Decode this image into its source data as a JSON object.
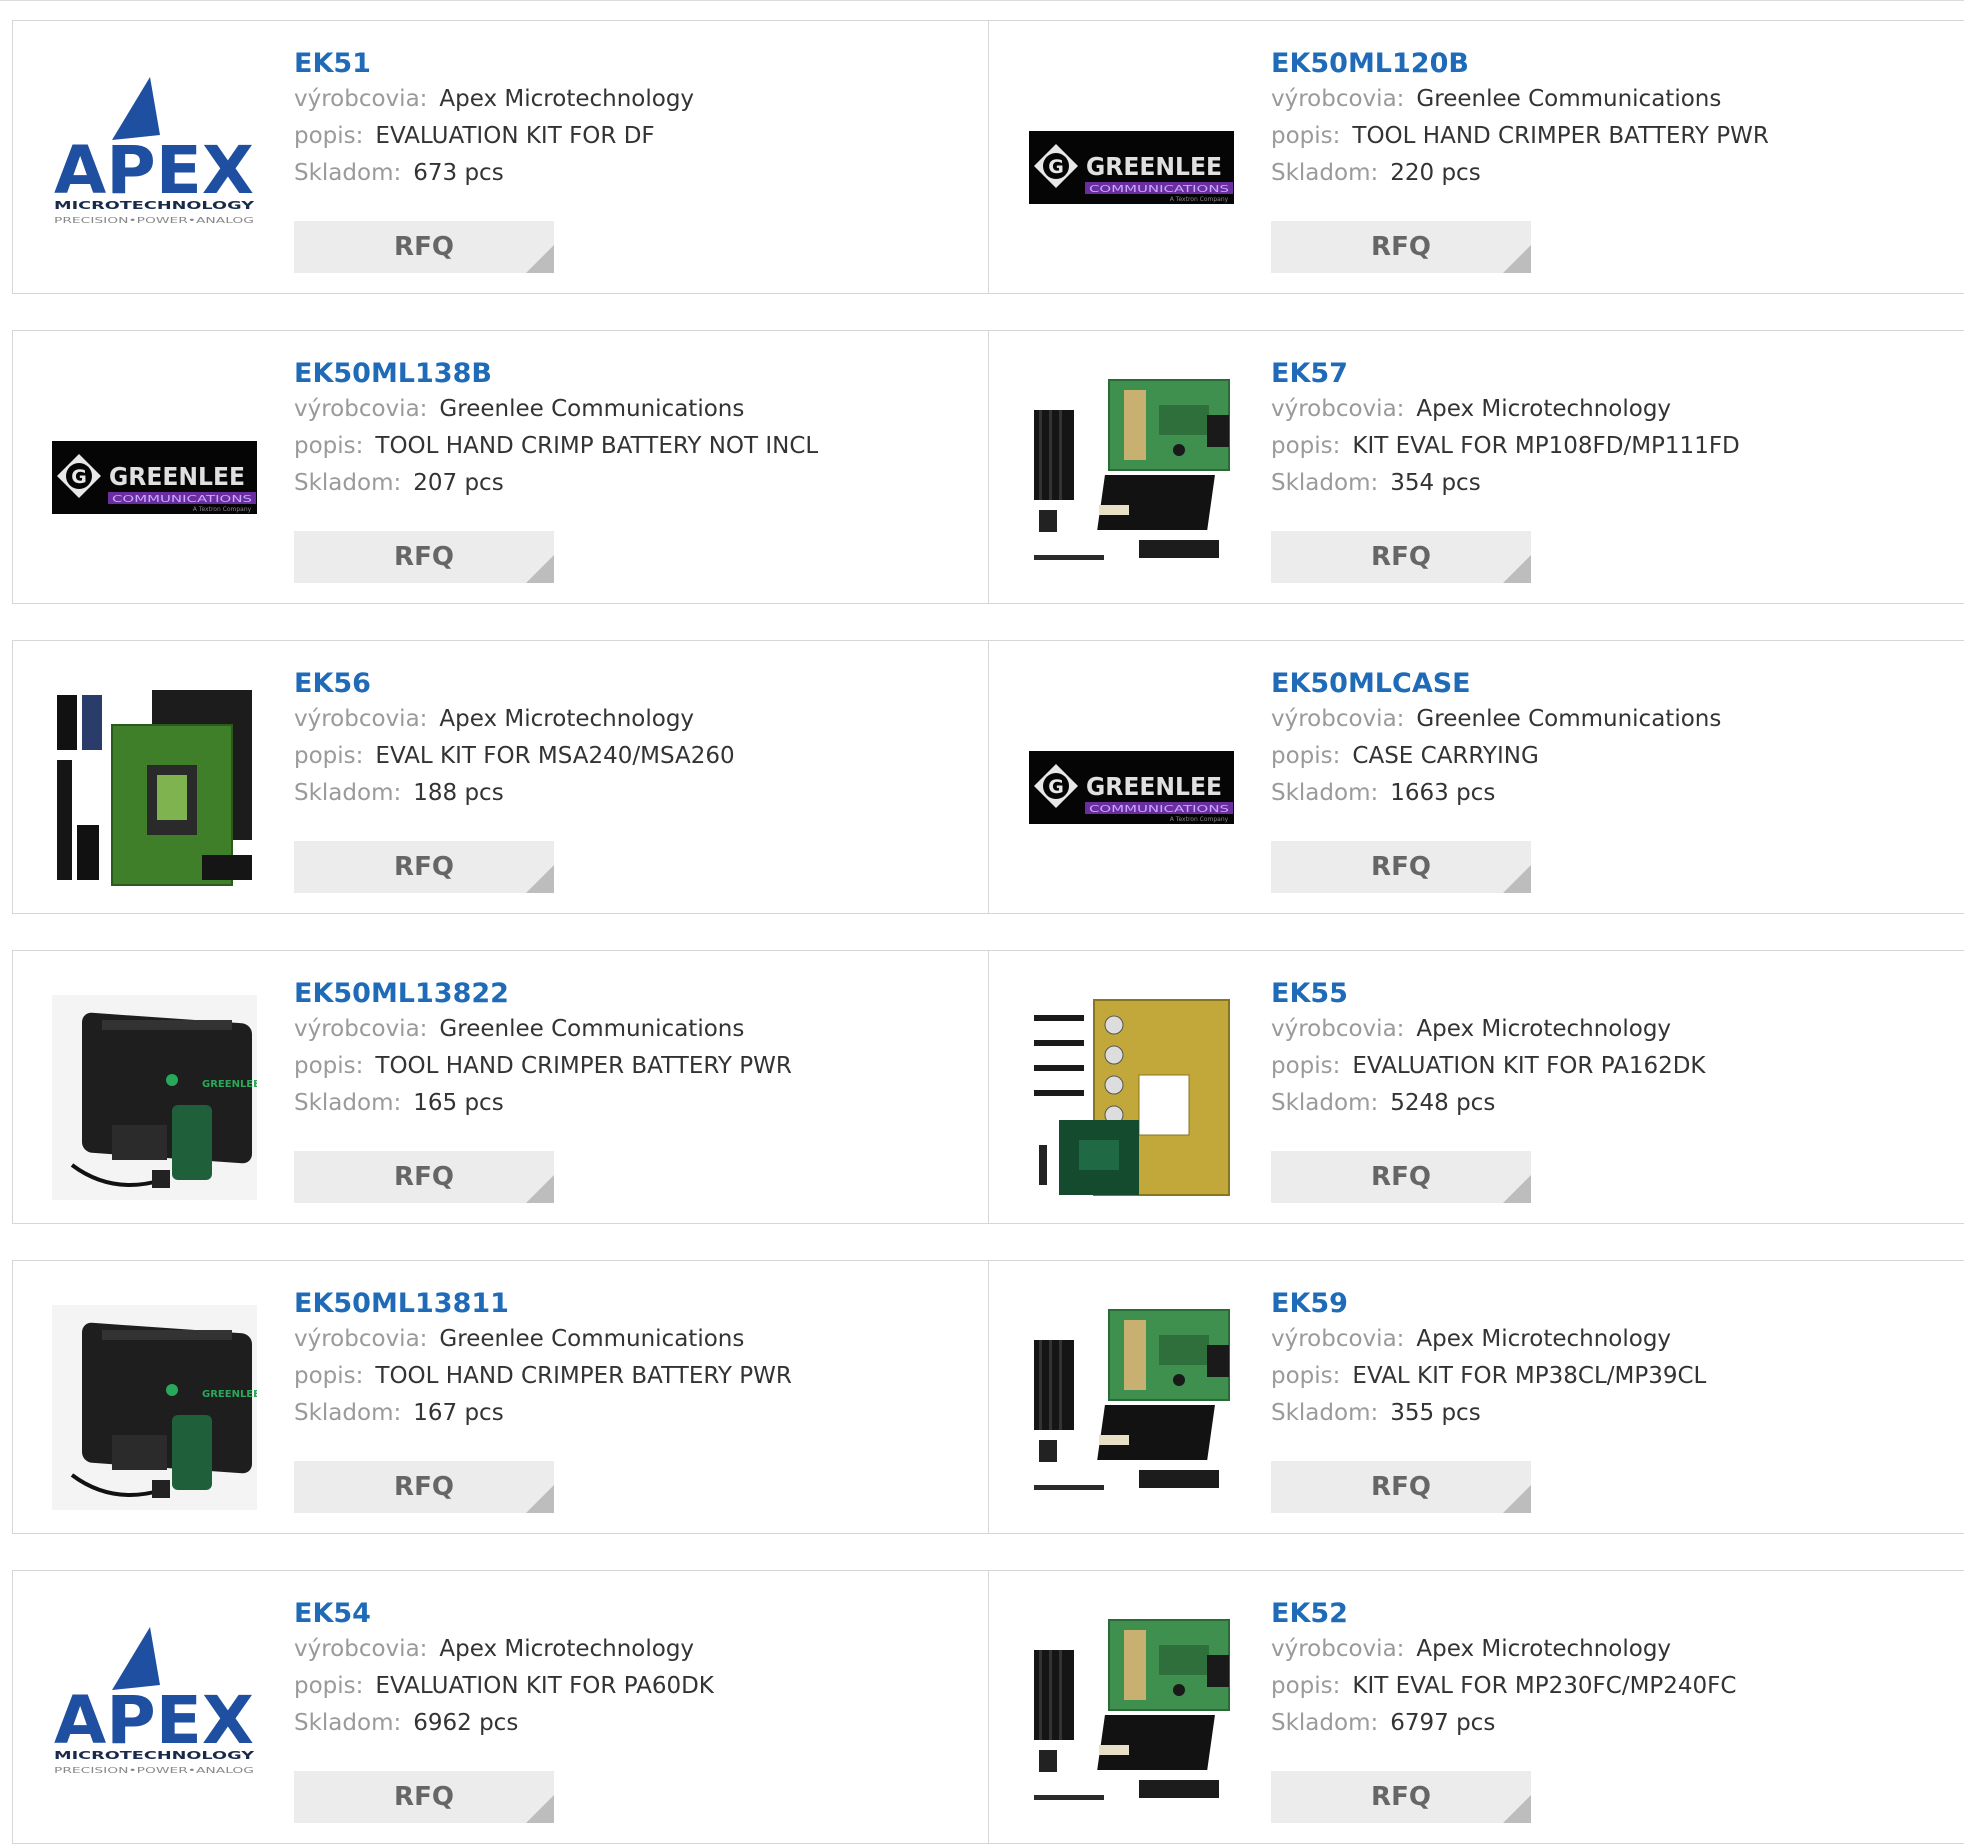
{
  "labels": {
    "manufacturer": "výrobcovia:",
    "description": "popis:",
    "stock": "Skladom:",
    "rfq": "RFQ"
  },
  "colors": {
    "link": "#1f6bb8",
    "apex_blue": "#1f4fa0",
    "greenlee_purple": "#6a2ea0"
  },
  "rows": [
    [
      {
        "name": "EK51",
        "manufacturer": "Apex Microtechnology",
        "description": "EVALUATION KIT FOR DF",
        "stock": "673 pcs",
        "image": "apex-logo"
      },
      {
        "name": "EK50ML120B",
        "manufacturer": "Greenlee Communications",
        "description": "TOOL HAND CRIMPER BATTERY PWR",
        "stock": "220 pcs",
        "image": "greenlee-logo"
      }
    ],
    [
      {
        "name": "EK50ML138B",
        "manufacturer": "Greenlee Communications",
        "description": "TOOL HAND CRIMP BATTERY NOT INCL",
        "stock": "207 pcs",
        "image": "greenlee-logo"
      },
      {
        "name": "EK57",
        "manufacturer": "Apex Microtechnology",
        "description": "KIT EVAL FOR MP108FD/MP111FD",
        "stock": "354 pcs",
        "image": "eval-board-heatsink"
      }
    ],
    [
      {
        "name": "EK56",
        "manufacturer": "Apex Microtechnology",
        "description": "EVAL KIT FOR MSA240/MSA260",
        "stock": "188 pcs",
        "image": "eval-board-large"
      },
      {
        "name": "EK50MLCASE",
        "manufacturer": "Greenlee Communications",
        "description": "CASE CARRYING",
        "stock": "1663 pcs",
        "image": "greenlee-logo"
      }
    ],
    [
      {
        "name": "EK50ML13822",
        "manufacturer": "Greenlee Communications",
        "description": "TOOL HAND CRIMPER BATTERY PWR",
        "stock": "165 pcs",
        "image": "crimper-kit-case"
      },
      {
        "name": "EK55",
        "manufacturer": "Apex Microtechnology",
        "description": "EVALUATION KIT FOR PA162DK",
        "stock": "5248 pcs",
        "image": "eval-board-perfboard"
      }
    ],
    [
      {
        "name": "EK50ML13811",
        "manufacturer": "Greenlee Communications",
        "description": "TOOL HAND CRIMPER BATTERY PWR",
        "stock": "167 pcs",
        "image": "crimper-kit-case"
      },
      {
        "name": "EK59",
        "manufacturer": "Apex Microtechnology",
        "description": "EVAL KIT FOR MP38CL/MP39CL",
        "stock": "355 pcs",
        "image": "eval-board-heatsink"
      }
    ],
    [
      {
        "name": "EK54",
        "manufacturer": "Apex Microtechnology",
        "description": "EVALUATION KIT FOR PA60DK",
        "stock": "6962 pcs",
        "image": "apex-logo"
      },
      {
        "name": "EK52",
        "manufacturer": "Apex Microtechnology",
        "description": "KIT EVAL FOR MP230FC/MP240FC",
        "stock": "6797 pcs",
        "image": "eval-board-heatsink"
      }
    ]
  ]
}
